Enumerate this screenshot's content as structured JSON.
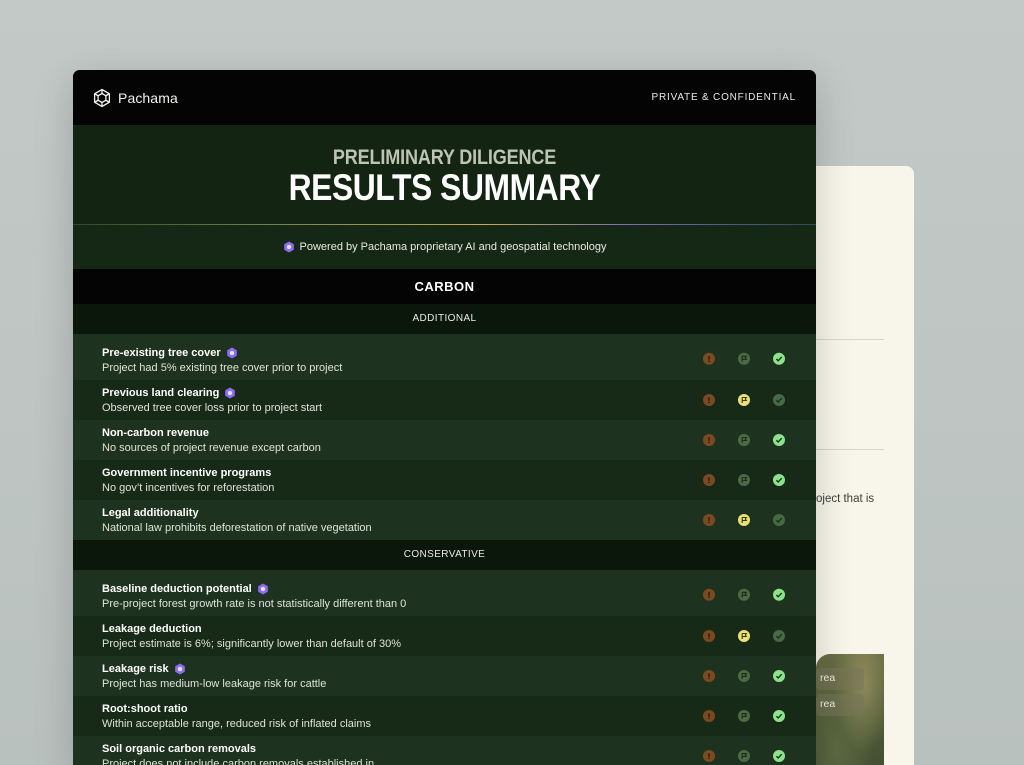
{
  "back": {
    "text_fragment": "oject that is",
    "map_chips": [
      "rea",
      "rea"
    ]
  },
  "header": {
    "logo_text": "Pachama",
    "confidential": "PRIVATE & CONFIDENTIAL"
  },
  "hero": {
    "subtitle": "PRELIMINARY DILIGENCE",
    "title": "RESULTS SUMMARY"
  },
  "powered_text": "Powered by Pachama proprietary AI and geospatial technology",
  "sections": [
    {
      "title": "CARBON",
      "subsections": [
        {
          "title": "ADDITIONAL",
          "rows": [
            {
              "title": "Pre-existing tree cover",
              "ai": true,
              "desc": "Project had 5% existing tree cover prior to project",
              "status": "check"
            },
            {
              "title": "Previous land clearing",
              "ai": true,
              "desc": "Observed tree cover loss prior to project start",
              "status": "flag"
            },
            {
              "title": "Non-carbon revenue",
              "ai": false,
              "desc": "No sources of project revenue except carbon",
              "status": "check"
            },
            {
              "title": "Government incentive programs",
              "ai": false,
              "desc": "No gov’t incentives for reforestation",
              "status": "check"
            },
            {
              "title": "Legal additionality",
              "ai": false,
              "desc": "National law prohibits deforestation of native vegetation",
              "status": "flag"
            }
          ]
        },
        {
          "title": "CONSERVATIVE",
          "rows": [
            {
              "title": "Baseline deduction potential",
              "ai": true,
              "desc": "Pre-project forest growth rate is not statistically different than 0",
              "status": "check"
            },
            {
              "title": "Leakage deduction",
              "ai": false,
              "desc": "Project estimate is 6%; significantly lower than default of 30%",
              "status": "flag"
            },
            {
              "title": "Leakage risk",
              "ai": true,
              "desc": "Project has medium-low leakage risk for cattle",
              "status": "check"
            },
            {
              "title": "Root:shoot ratio",
              "ai": false,
              "desc": "Within acceptable range, reduced risk of inflated claims",
              "status": "check"
            },
            {
              "title": "Soil organic carbon removals",
              "ai": false,
              "desc": "Project does not include carbon removals established in",
              "status": "check"
            }
          ]
        }
      ]
    }
  ],
  "colors": {
    "card_bg": "#11200f",
    "topbar_bg": "#030403",
    "check_active": "#8de28c",
    "flag_active": "#e9e27a",
    "warn": "#7a4a21",
    "ai_badge": "#8b6cf0"
  },
  "icons": {
    "warn": "exclamation-icon",
    "flag": "flag-icon",
    "check": "check-icon",
    "ai": "ai-hexagon-icon",
    "logo": "pachama-logo-icon"
  }
}
